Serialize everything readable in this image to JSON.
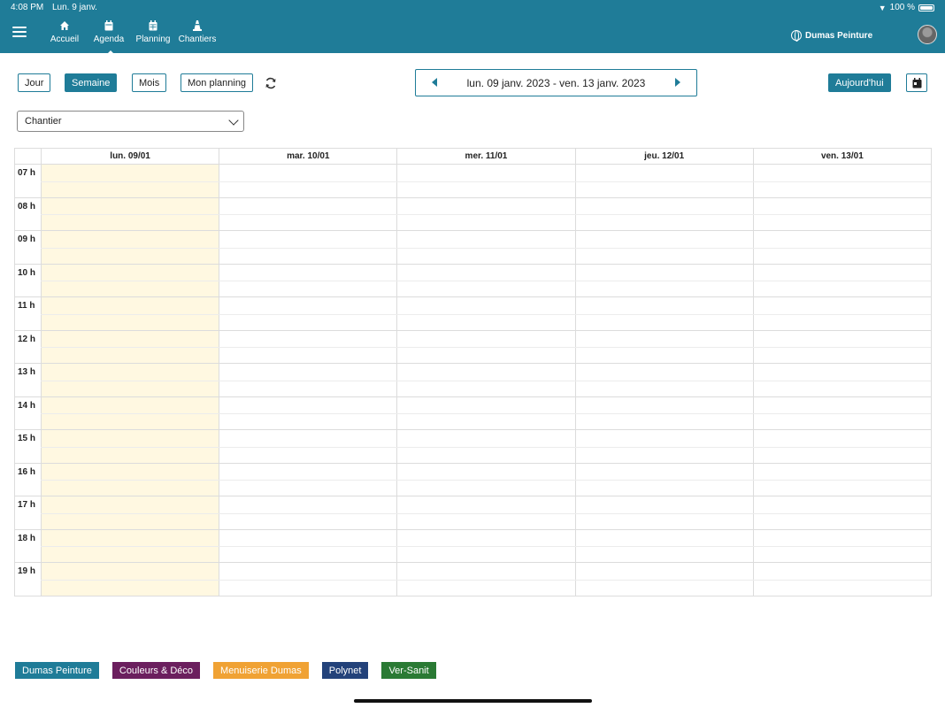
{
  "status": {
    "time": "4:08 PM",
    "date": "Lun. 9 janv.",
    "battery": "100 %"
  },
  "nav": [
    {
      "label": "Accueil",
      "icon": "home-icon"
    },
    {
      "label": "Agenda",
      "icon": "calendar-icon"
    },
    {
      "label": "Planning",
      "icon": "calendar-grid-icon"
    },
    {
      "label": "Chantiers",
      "icon": "traffic-cone-icon"
    }
  ],
  "company": "Dumas Peinture",
  "views": {
    "day": "Jour",
    "week": "Semaine",
    "month": "Mois",
    "mine": "Mon planning"
  },
  "date_range": "lun. 09 janv. 2023 - ven. 13 janv. 2023",
  "today_label": "Aujourd'hui",
  "filter": {
    "selected": "Chantier"
  },
  "days": [
    "lun. 09/01",
    "mar. 10/01",
    "mer. 11/01",
    "jeu. 12/01",
    "ven. 13/01"
  ],
  "hours": [
    "07 h",
    "08 h",
    "09 h",
    "10 h",
    "11 h",
    "12 h",
    "13 h",
    "14 h",
    "15 h",
    "16 h",
    "17 h",
    "18 h",
    "19 h"
  ],
  "legend": [
    {
      "label": "Dumas Peinture",
      "color": "#1f7c98"
    },
    {
      "label": "Couleurs & Déco",
      "color": "#6b1f5e"
    },
    {
      "label": "Menuiserie Dumas",
      "color": "#f0a234"
    },
    {
      "label": "Polynet",
      "color": "#23427a"
    },
    {
      "label": "Ver-Sanit",
      "color": "#2a7a34"
    }
  ]
}
